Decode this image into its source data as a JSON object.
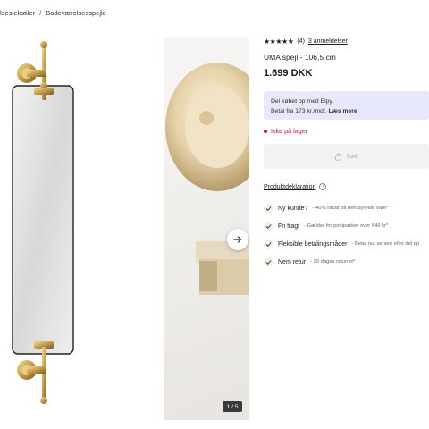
{
  "breadcrumb": {
    "items": [
      "lsestekstiler",
      "Badeværelsesspejle"
    ],
    "separator": "/"
  },
  "gallery": {
    "counter": "1 / 5",
    "next_icon": "arrow-right-icon"
  },
  "product": {
    "stars": "★★★★★",
    "rating_count": "(4)",
    "reviews_link": "3 anmeldelser",
    "title": "UMA spejl - 106,5 cm",
    "price": "1.699 DKK",
    "elpy_line1": "Del købet op med Elpy.",
    "elpy_line2": "Betal fra 173 kr./mdr.",
    "elpy_more": "Læs mere",
    "stock": "Ikke på lager",
    "buy_label": "Køb",
    "declaration": "Produktdeklaration",
    "declaration_info": "i"
  },
  "perks": [
    {
      "title": "Ny kunde?",
      "sub": "- 40% rabat på den dyreste vare*"
    },
    {
      "title": "Fri fragt",
      "sub": "- Gælder for postpakker over 649 kr*"
    },
    {
      "title": "Fleksible betalingsmåder",
      "sub": "- Betal nu, senere eller del op"
    },
    {
      "title": "Nem retur",
      "sub": "- 30 dages returret*"
    }
  ],
  "colors": {
    "accent_error": "#d0142c",
    "elpy_bg": "#e7e9fb",
    "brass": "#c9a24e"
  }
}
